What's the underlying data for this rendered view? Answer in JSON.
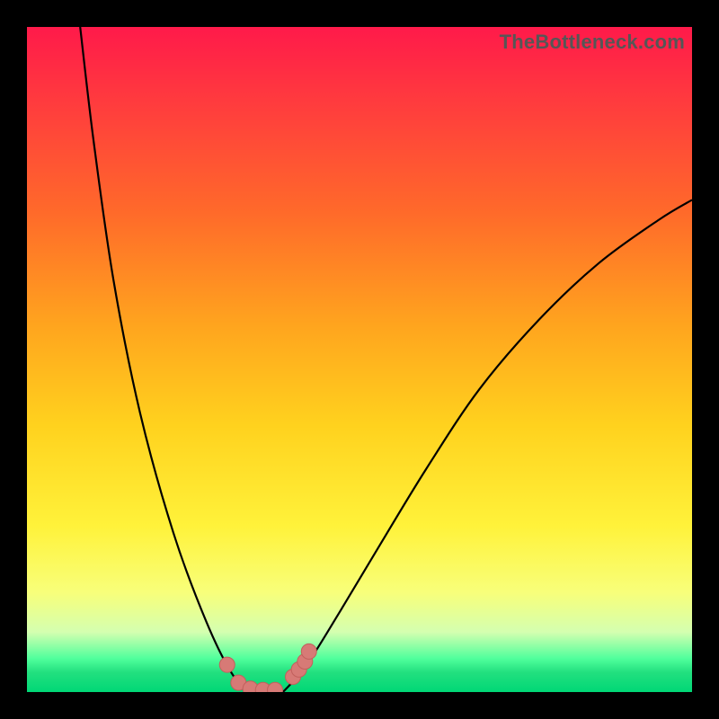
{
  "watermark": "TheBottleneck.com",
  "colors": {
    "curve_stroke": "#000000",
    "marker_fill": "#d77a76",
    "marker_stroke": "#c2605c"
  },
  "chart_data": {
    "type": "line",
    "title": "",
    "xlabel": "",
    "ylabel": "",
    "xlim": [
      0,
      100
    ],
    "ylim": [
      0,
      100
    ],
    "series": [
      {
        "name": "left-branch",
        "x": [
          8,
          10,
          13,
          17,
          22,
          27,
          31,
          33.8
        ],
        "y": [
          100,
          83,
          62,
          42,
          24,
          10.5,
          2.5,
          0
        ]
      },
      {
        "name": "right-branch",
        "x": [
          38.5,
          42,
          47,
          53,
          60,
          68,
          77,
          86,
          95,
          100
        ],
        "y": [
          0,
          4,
          12,
          22,
          33.5,
          45.5,
          56,
          64.5,
          71,
          74
        ]
      },
      {
        "name": "valley-floor",
        "x": [
          33.8,
          35.5,
          37,
          38.5
        ],
        "y": [
          0,
          0,
          0,
          0
        ]
      },
      {
        "name": "markers",
        "x": [
          30.1,
          31.8,
          33.6,
          35.5,
          37.3,
          40.0,
          40.9,
          41.8,
          42.4
        ],
        "y": [
          4.1,
          1.4,
          0.5,
          0.3,
          0.3,
          2.3,
          3.4,
          4.6,
          6.1
        ]
      }
    ]
  }
}
